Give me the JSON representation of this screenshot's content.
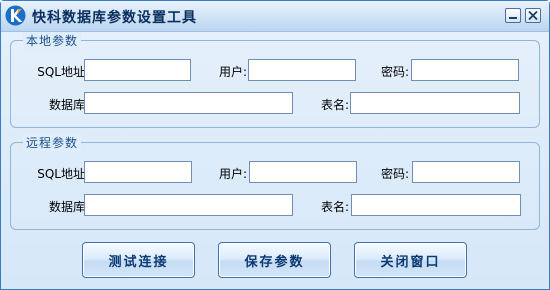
{
  "window": {
    "title": "快科数据库参数设置工具",
    "icon": "app-logo-icon",
    "controls": {
      "minimize_icon": "minimize-icon",
      "close_icon": "close-icon"
    }
  },
  "local": {
    "legend": "本地参数",
    "sql_label": "SQL地址:",
    "user_label": "用户:",
    "password_label": "密码:",
    "database_label": "数据库:",
    "table_label": "表名:",
    "sql_value": "",
    "user_value": "",
    "password_value": "",
    "database_value": "",
    "table_value": ""
  },
  "remote": {
    "legend": "远程参数",
    "sql_label": "SQL地址:",
    "user_label": "用户:",
    "password_label": "密码:",
    "database_label": "数据库:",
    "table_label": "表名:",
    "sql_value": "",
    "user_value": "",
    "password_value": "",
    "database_value": "",
    "table_value": ""
  },
  "buttons": {
    "test": "测试连接",
    "save": "保存参数",
    "close": "关闭窗口"
  },
  "colors": {
    "title_text": "#0b2f5e",
    "window_bg": "#dbeaf9",
    "group_border": "#8fb6dc",
    "legend_text": "#1a4f8a",
    "button_text": "#0d3a73"
  }
}
